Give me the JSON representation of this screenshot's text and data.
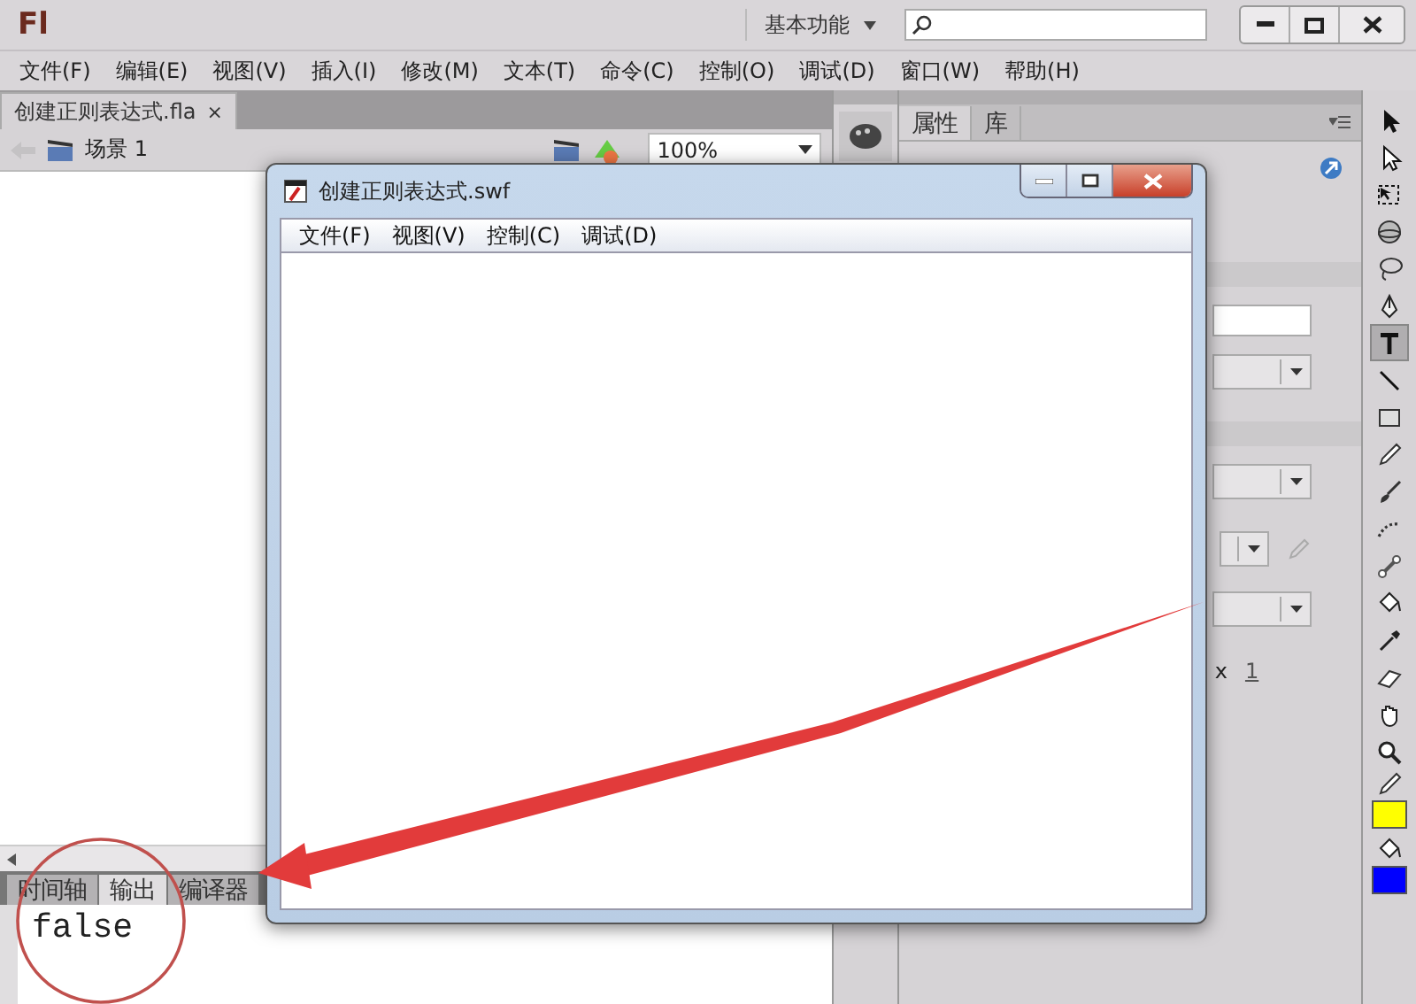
{
  "title_bar": {
    "logo": "Fl",
    "workspace": "基本功能"
  },
  "menu": [
    "文件(F)",
    "编辑(E)",
    "视图(V)",
    "插入(I)",
    "修改(M)",
    "文本(T)",
    "命令(C)",
    "控制(O)",
    "调试(D)",
    "窗口(W)",
    "帮助(H)"
  ],
  "document": {
    "tab": {
      "label": "创建正则表达式.fla",
      "close": "×"
    },
    "scene": "场景 1",
    "zoom": "100%"
  },
  "bottom_panel": {
    "tabs": [
      {
        "label": "时间轴",
        "selected": false
      },
      {
        "label": "输出",
        "selected": true
      },
      {
        "label": "编译器",
        "selected": false
      }
    ],
    "output": "false"
  },
  "properties": {
    "tabs": [
      {
        "label": "属性",
        "selected": true
      },
      {
        "label": "库",
        "selected": false
      }
    ],
    "stroke_x": "x",
    "stroke_value": "1"
  },
  "tools": [
    {
      "kind": "select",
      "selected": false
    },
    {
      "kind": "subselect",
      "selected": false
    },
    {
      "kind": "transform",
      "selected": false
    },
    {
      "kind": "rotate3d",
      "selected": false
    },
    {
      "kind": "lasso",
      "selected": false
    },
    {
      "kind": "pen",
      "selected": false
    },
    {
      "kind": "text",
      "selected": true
    },
    {
      "kind": "line",
      "selected": false
    },
    {
      "kind": "rect",
      "selected": false
    },
    {
      "kind": "pencil",
      "selected": false
    },
    {
      "kind": "brush",
      "selected": false
    },
    {
      "kind": "deco",
      "selected": false
    },
    {
      "kind": "bone",
      "selected": false
    },
    {
      "kind": "bucket",
      "selected": false
    },
    {
      "kind": "dropper",
      "selected": false
    },
    {
      "kind": "eraser",
      "selected": false
    },
    {
      "kind": "hand",
      "selected": false
    },
    {
      "kind": "zoom",
      "selected": false
    }
  ],
  "swatches": [
    {
      "kind": "stroke",
      "color": "#ffff00"
    },
    {
      "kind": "fill",
      "color": "#0000ff"
    }
  ],
  "swf_window": {
    "title": "创建正则表达式.swf",
    "menu": [
      "文件(F)",
      "视图(V)",
      "控制(C)",
      "调试(D)"
    ]
  }
}
